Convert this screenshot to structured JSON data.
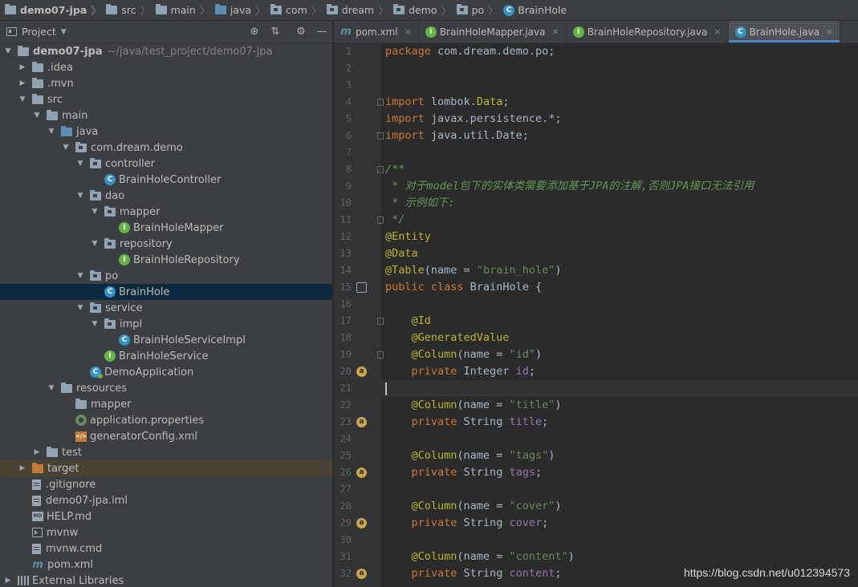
{
  "breadcrumbs": [
    {
      "label": "demo07-jpa",
      "icon": "folder",
      "bold": true
    },
    {
      "label": "src",
      "icon": "folder"
    },
    {
      "label": "main",
      "icon": "folder"
    },
    {
      "label": "java",
      "icon": "folder-blue"
    },
    {
      "label": "com",
      "icon": "package"
    },
    {
      "label": "dream",
      "icon": "package"
    },
    {
      "label": "demo",
      "icon": "package"
    },
    {
      "label": "po",
      "icon": "package"
    },
    {
      "label": "BrainHole",
      "icon": "class"
    }
  ],
  "project_panel": {
    "title": "Project",
    "tree": [
      {
        "label": "demo07-jpa",
        "suffix": "~/java/test_project/demo07-jpa",
        "depth": 0,
        "arrow": "down",
        "icon": "folder",
        "bold": true
      },
      {
        "label": ".idea",
        "depth": 1,
        "arrow": "right",
        "icon": "folder"
      },
      {
        "label": ".mvn",
        "depth": 1,
        "arrow": "right",
        "icon": "folder"
      },
      {
        "label": "src",
        "depth": 1,
        "arrow": "down",
        "icon": "folder"
      },
      {
        "label": "main",
        "depth": 2,
        "arrow": "down",
        "icon": "folder"
      },
      {
        "label": "java",
        "depth": 3,
        "arrow": "down",
        "icon": "folder-blue"
      },
      {
        "label": "com.dream.demo",
        "depth": 4,
        "arrow": "down",
        "icon": "package"
      },
      {
        "label": "controller",
        "depth": 5,
        "arrow": "down",
        "icon": "package"
      },
      {
        "label": "BrainHoleController",
        "depth": 6,
        "arrow": "",
        "icon": "class"
      },
      {
        "label": "dao",
        "depth": 5,
        "arrow": "down",
        "icon": "package"
      },
      {
        "label": "mapper",
        "depth": 6,
        "arrow": "down",
        "icon": "package"
      },
      {
        "label": "BrainHoleMapper",
        "depth": 7,
        "arrow": "",
        "icon": "interface"
      },
      {
        "label": "repository",
        "depth": 6,
        "arrow": "down",
        "icon": "package"
      },
      {
        "label": "BrainHoleRepository",
        "depth": 7,
        "arrow": "",
        "icon": "interface"
      },
      {
        "label": "po",
        "depth": 5,
        "arrow": "down",
        "icon": "package"
      },
      {
        "label": "BrainHole",
        "depth": 6,
        "arrow": "",
        "icon": "class",
        "selected": true
      },
      {
        "label": "service",
        "depth": 5,
        "arrow": "down",
        "icon": "package"
      },
      {
        "label": "impl",
        "depth": 6,
        "arrow": "down",
        "icon": "package"
      },
      {
        "label": "BrainHoleServiceImpl",
        "depth": 7,
        "arrow": "",
        "icon": "class"
      },
      {
        "label": "BrainHoleService",
        "depth": 6,
        "arrow": "",
        "icon": "interface"
      },
      {
        "label": "DemoApplication",
        "depth": 5,
        "arrow": "",
        "icon": "app"
      },
      {
        "label": "resources",
        "depth": 3,
        "arrow": "down",
        "icon": "folder"
      },
      {
        "label": "mapper",
        "depth": 4,
        "arrow": "",
        "icon": "folder"
      },
      {
        "label": "application.properties",
        "depth": 4,
        "arrow": "",
        "icon": "properties"
      },
      {
        "label": "generatorConfig.xml",
        "depth": 4,
        "arrow": "",
        "icon": "xml"
      },
      {
        "label": "test",
        "depth": 2,
        "arrow": "right",
        "icon": "folder"
      },
      {
        "label": "target",
        "depth": 1,
        "arrow": "right",
        "icon": "folder-orange",
        "highlight": true
      },
      {
        "label": ".gitignore",
        "depth": 1,
        "arrow": "",
        "icon": "file"
      },
      {
        "label": "demo07-jpa.iml",
        "depth": 1,
        "arrow": "",
        "icon": "file"
      },
      {
        "label": "HELP.md",
        "depth": 1,
        "arrow": "",
        "icon": "md"
      },
      {
        "label": "mvnw",
        "depth": 1,
        "arrow": "",
        "icon": "terminal"
      },
      {
        "label": "mvnw.cmd",
        "depth": 1,
        "arrow": "",
        "icon": "file"
      },
      {
        "label": "pom.xml",
        "depth": 1,
        "arrow": "",
        "icon": "maven"
      },
      {
        "label": "External Libraries",
        "depth": 0,
        "arrow": "right",
        "icon": "libraries"
      }
    ]
  },
  "tabs": [
    {
      "label": "pom.xml",
      "icon": "maven",
      "active": false
    },
    {
      "label": "BrainHoleMapper.java",
      "icon": "interface",
      "active": false
    },
    {
      "label": "BrainHoleRepository.java",
      "icon": "interface",
      "active": false
    },
    {
      "label": "BrainHole.java",
      "icon": "class",
      "active": true
    }
  ],
  "code_lines": [
    {
      "n": "1",
      "html": "<span class=\"kw\">package</span> com.dream.demo.po;"
    },
    {
      "n": "2",
      "html": ""
    },
    {
      "n": "3",
      "html": ""
    },
    {
      "n": "4",
      "html": "<span class=\"kw\">import</span> lombok.<span class=\"an\">Data</span>;",
      "fold": true
    },
    {
      "n": "5",
      "html": "<span class=\"kw\">import</span> javax.persistence.*;"
    },
    {
      "n": "6",
      "html": "<span class=\"kw\">import</span> java.util.Date;",
      "fold": true
    },
    {
      "n": "7",
      "html": ""
    },
    {
      "n": "8",
      "html": "<span class=\"cm\">/**</span>",
      "fold": true
    },
    {
      "n": "9",
      "html": "<span class=\"cm\"> * 对于<i>model</i>包下的实体类需要添加基于<i>JPA</i>的注解,否则<i>JPA</i>接口无法引用</span>"
    },
    {
      "n": "10",
      "html": "<span class=\"cm\"> * 示例如下:</span>"
    },
    {
      "n": "11",
      "html": "<span class=\"cm\"> */</span>",
      "fold": true
    },
    {
      "n": "12",
      "html": "<span class=\"an\">@Entity</span>"
    },
    {
      "n": "13",
      "html": "<span class=\"an\">@Data</span>"
    },
    {
      "n": "14",
      "html": "<span class=\"an\">@Table</span>(name = <span class=\"st\">\"brain_hole\"</span>)"
    },
    {
      "n": "15",
      "html": "<span class=\"kw\">public class</span> BrainHole {",
      "gutter": "db"
    },
    {
      "n": "16",
      "html": ""
    },
    {
      "n": "17",
      "html": "    <span class=\"an\">@Id</span>",
      "fold": true
    },
    {
      "n": "18",
      "html": "    <span class=\"an\">@GeneratedValue</span>"
    },
    {
      "n": "19",
      "html": "    <span class=\"an\">@Column</span>(name = <span class=\"st\">\"id\"</span>)",
      "fold": true
    },
    {
      "n": "20",
      "html": "    <span class=\"kw\">private</span> Integer <span class=\"fd\">id</span>;",
      "gutter": "a"
    },
    {
      "n": "21",
      "html": "",
      "current": true
    },
    {
      "n": "22",
      "html": "    <span class=\"an\">@Column</span>(name = <span class=\"st\">\"title\"</span>)"
    },
    {
      "n": "23",
      "html": "    <span class=\"kw\">private</span> String <span class=\"fd\">title</span>;",
      "gutter": "a"
    },
    {
      "n": "24",
      "html": ""
    },
    {
      "n": "25",
      "html": "    <span class=\"an\">@Column</span>(name = <span class=\"st\">\"tags\"</span>)"
    },
    {
      "n": "26",
      "html": "    <span class=\"kw\">private</span> String <span class=\"fd\">tags</span>;",
      "gutter": "a"
    },
    {
      "n": "27",
      "html": ""
    },
    {
      "n": "28",
      "html": "    <span class=\"an\">@Column</span>(name = <span class=\"st\">\"cover\"</span>)"
    },
    {
      "n": "29",
      "html": "    <span class=\"kw\">private</span> String <span class=\"fd\">cover</span>;",
      "gutter": "a"
    },
    {
      "n": "30",
      "html": ""
    },
    {
      "n": "31",
      "html": "    <span class=\"an\">@Column</span>(name = <span class=\"st\">\"content\"</span>)"
    },
    {
      "n": "32",
      "html": "    <span class=\"kw\">private</span> String <span class=\"fd\">content</span>;",
      "gutter": "a"
    }
  ],
  "watermark": "https://blog.csdn.net/u012394573",
  "colors": {
    "selection": "#0d293e",
    "tab_accent": "#4a88c7",
    "keyword": "#cc7832",
    "annotation": "#bbb529",
    "string": "#6a8759",
    "field": "#9876aa"
  }
}
